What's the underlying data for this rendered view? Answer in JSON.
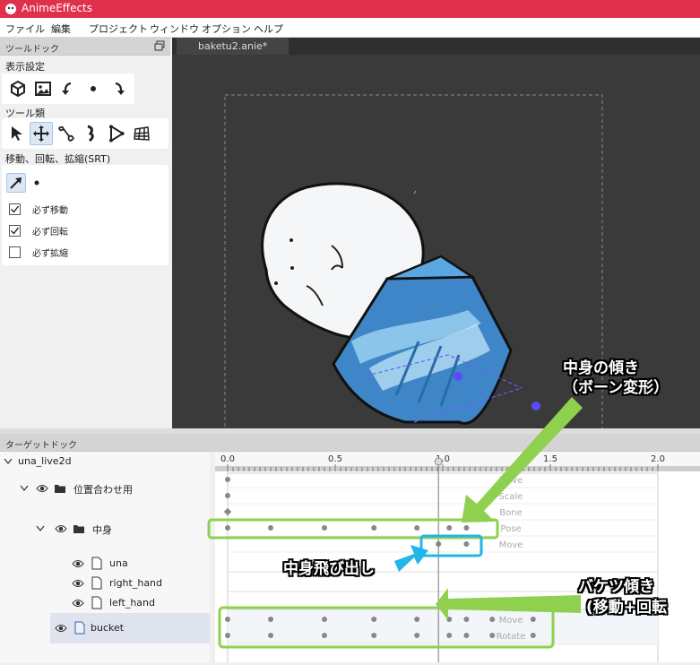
{
  "window": {
    "title": "AnimeEffects"
  },
  "menu": [
    "ファイル",
    "編集",
    "プロジェクト",
    "ウィンドウ",
    "オプション",
    "ヘルプ"
  ],
  "tool_dock": {
    "title": "ツールドック",
    "display_settings_label": "表示設定",
    "display_buttons": [
      "cube-icon",
      "image-icon",
      "rotate-left-icon",
      "dot-icon",
      "rotate-right-icon"
    ],
    "tools_label": "ツール類",
    "tools": [
      "cursor-icon",
      "move-arrows-icon",
      "bone-icon",
      "pose-icon",
      "mesh-icon",
      "ffd-grid-icon"
    ],
    "srt_label": "移動、回転、拡縮(SRT)",
    "srt_modes": [
      "move-arrow-icon",
      "dot-icon"
    ],
    "checkboxes": [
      {
        "label": "必ず移動",
        "checked": true
      },
      {
        "label": "必ず回転",
        "checked": true
      },
      {
        "label": "必ず拡縮",
        "checked": false
      }
    ]
  },
  "editor": {
    "tab_label": "baketu2.anie*"
  },
  "target_dock": {
    "title": "ターゲットドック",
    "tree": [
      {
        "label": "una_live2d",
        "type": "root"
      },
      {
        "label": "位置合わせ用",
        "type": "folder"
      },
      {
        "label": "中身",
        "type": "folder"
      },
      {
        "label": "una",
        "type": "file"
      },
      {
        "label": "right_hand",
        "type": "file"
      },
      {
        "label": "left_hand",
        "type": "file"
      },
      {
        "label": "bucket",
        "type": "file",
        "selected": true
      }
    ]
  },
  "timeline": {
    "ruler_labels": [
      "0.0",
      "0.5",
      "1.0",
      "1.5",
      "2.0"
    ],
    "ruler_range": [
      0,
      2
    ],
    "playhead": 0.98,
    "tracks": [
      {
        "label": "Move",
        "keys": [
          0.0
        ]
      },
      {
        "label": "Scale",
        "keys": [
          0.0
        ]
      },
      {
        "label": "Bone",
        "keys": [
          0.0
        ]
      },
      {
        "label": "Pose",
        "keys": [
          0.0,
          0.2,
          0.45,
          0.68,
          0.88,
          1.03,
          1.11
        ]
      },
      {
        "label": "Move",
        "keys": [
          0.98,
          1.11
        ]
      },
      {
        "label": "Move",
        "keys": [
          0.0,
          0.2,
          0.45,
          0.68,
          0.88,
          1.03,
          1.11,
          1.23,
          1.42
        ]
      },
      {
        "label": "Rotate",
        "keys": [
          0.0,
          0.2,
          0.45,
          0.68,
          0.88,
          1.03,
          1.11,
          1.23,
          1.42
        ]
      }
    ]
  },
  "annotations": {
    "tilt_line1": "中身の傾き",
    "tilt_line2": "（ボーン変形）",
    "popout": "中身飛び出し",
    "bucket_line1": "バケツ傾き",
    "bucket_line2": "(移動+回転"
  },
  "colors": {
    "titlebar": "#e0314c",
    "annotation_green": "#8fd14f",
    "annotation_blue": "#21b6e8"
  }
}
